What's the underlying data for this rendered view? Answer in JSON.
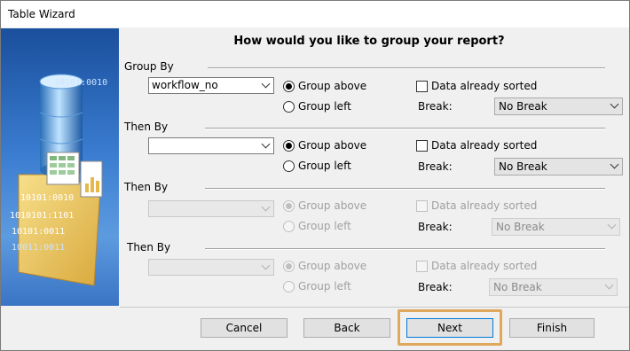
{
  "window": {
    "title": "Table Wizard"
  },
  "header": {
    "question": "How would you like to group your report?"
  },
  "groups": [
    {
      "label": "Group By",
      "field_value": "workflow_no",
      "option_above": "Group above",
      "option_left": "Group left",
      "sorted_label": "Data already sorted",
      "break_label": "Break:",
      "break_value": "No Break"
    },
    {
      "label": "Then By",
      "field_value": "",
      "option_above": "Group above",
      "option_left": "Group left",
      "sorted_label": "Data already sorted",
      "break_label": "Break:",
      "break_value": "No Break"
    },
    {
      "label": "Then By",
      "field_value": "",
      "option_above": "Group above",
      "option_left": "Group left",
      "sorted_label": "Data already sorted",
      "break_label": "Break:",
      "break_value": "No Break"
    },
    {
      "label": "Then By",
      "field_value": "",
      "option_above": "Group above",
      "option_left": "Group left",
      "sorted_label": "Data already sorted",
      "break_label": "Break:",
      "break_value": "No Break"
    }
  ],
  "art": {
    "binary_text": [
      "10101:0010",
      "1010101:1101",
      "10101:0011",
      "10011:0011",
      "10101:0010"
    ]
  },
  "buttons": {
    "cancel": "Cancel",
    "back": "Back",
    "next": "Next",
    "finish": "Finish"
  }
}
